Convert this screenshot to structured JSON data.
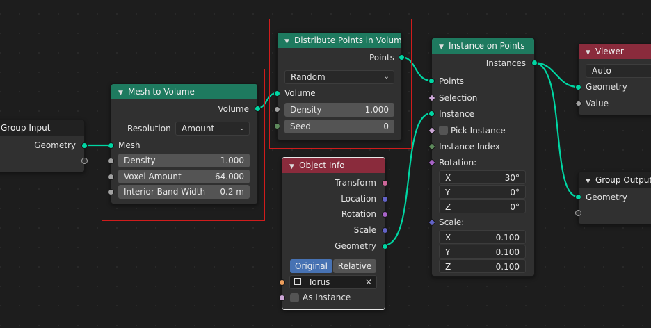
{
  "colors": {
    "background": "#1d1d1d",
    "node_body": "#303030",
    "geometry_socket": "#00d6a3",
    "geometry_header": "#1e7a5f",
    "input_header": "#8a2b3c",
    "highlight_frame": "#d01c1c",
    "active_button": "#4772b3"
  },
  "nodes": {
    "group_input": {
      "title": "Group Input",
      "outputs": [
        "Geometry"
      ]
    },
    "mesh_to_volume": {
      "title": "Mesh to Volume",
      "output": "Volume",
      "resolution_label": "Resolution",
      "resolution_value": "Amount",
      "input_mesh": "Mesh",
      "fields": [
        {
          "label": "Density",
          "value": "1.000"
        },
        {
          "label": "Voxel Amount",
          "value": "64.000"
        },
        {
          "label": "Interior Band Width",
          "value": "0.2 m"
        }
      ]
    },
    "distribute": {
      "title": "Distribute Points in Volume",
      "output": "Points",
      "mode": "Random",
      "input_volume": "Volume",
      "fields": [
        {
          "label": "Density",
          "value": "1.000"
        },
        {
          "label": "Seed",
          "value": "0"
        }
      ]
    },
    "object_info": {
      "title": "Object Info",
      "outputs": [
        "Transform",
        "Location",
        "Rotation",
        "Scale",
        "Geometry"
      ],
      "toggle": [
        "Original",
        "Relative"
      ],
      "object": "Torus",
      "as_instance": "As Instance"
    },
    "instance_on_points": {
      "title": "Instance on Points",
      "output": "Instances",
      "inputs": [
        "Points",
        "Selection",
        "Instance",
        "Pick Instance",
        "Instance Index"
      ],
      "rotation_label": "Rotation:",
      "rotation": [
        {
          "axis": "X",
          "value": "30°"
        },
        {
          "axis": "Y",
          "value": "0°"
        },
        {
          "axis": "Z",
          "value": "0°"
        }
      ],
      "scale_label": "Scale:",
      "scale": [
        {
          "axis": "X",
          "value": "0.100"
        },
        {
          "axis": "Y",
          "value": "0.100"
        },
        {
          "axis": "Z",
          "value": "0.100"
        }
      ]
    },
    "viewer": {
      "title": "Viewer",
      "mode": "Auto",
      "inputs": [
        "Geometry",
        "Value"
      ]
    },
    "group_output": {
      "title": "Group Output",
      "inputs": [
        "Geometry"
      ]
    }
  }
}
